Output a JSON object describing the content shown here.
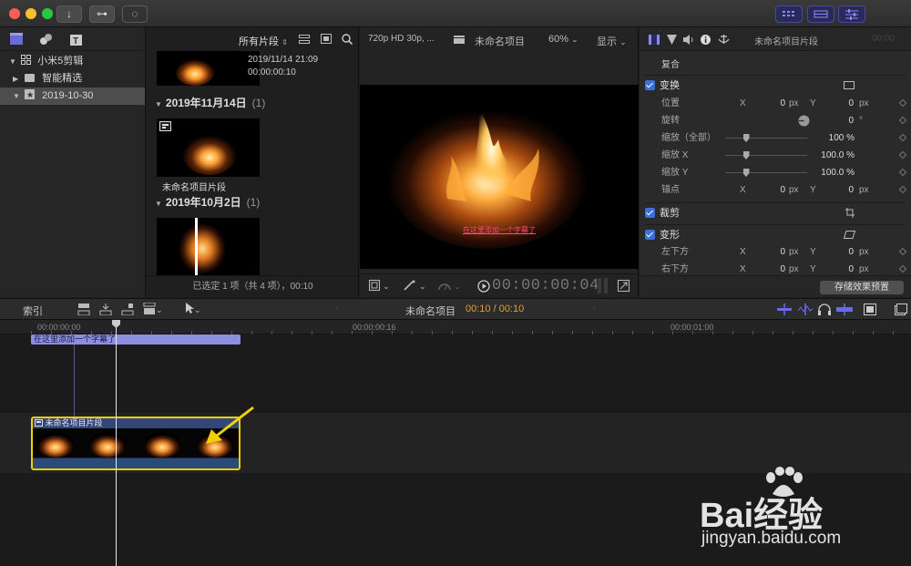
{
  "toolbar": {
    "import_icon": "↓",
    "keywords_icon": "⊶",
    "progress_icon": "◌"
  },
  "libraries": {
    "items": [
      {
        "label": "小米5剪辑",
        "icon": "library-icon",
        "expanded": true
      },
      {
        "label": "智能精选",
        "icon": "folder-icon",
        "expanded": false
      },
      {
        "label": "2019-10-30",
        "icon": "event-icon",
        "expanded": true,
        "selected": true
      }
    ]
  },
  "browser": {
    "filter_label": "所有片段",
    "top_clip": {
      "date": "2019/11/14 21:09",
      "duration": "00:00:00:10"
    },
    "groups": [
      {
        "date": "2019年11月14日",
        "count": "(1)",
        "clip_name": "未命名项目片段"
      },
      {
        "date": "2019年10月2日",
        "count": "(1)"
      }
    ],
    "status": "已选定 1 项（共 4 项），00:10"
  },
  "viewer": {
    "format": "720p HD 30p, ...",
    "project_name": "未命名项目",
    "zoom": "60%",
    "display": "显示",
    "subtitle": "在这里添加一个字幕了",
    "timecode": "00:00:00:04"
  },
  "inspector": {
    "clip_title": "未命名项目片段",
    "timecode_ghost": "00:00",
    "composite": "复合",
    "transform": "变换",
    "rows": [
      {
        "label": "位置",
        "x_label": "X",
        "x_val": "0",
        "x_unit": "px",
        "y_label": "Y",
        "y_val": "0",
        "y_unit": "px"
      },
      {
        "label": "旋转",
        "val": "0",
        "unit": "°"
      },
      {
        "label": "缩放（全部）",
        "val": "100 %",
        "slider": 0.25
      },
      {
        "label": "缩放 X",
        "val": "100.0 %",
        "slider": 0.25
      },
      {
        "label": "缩放 Y",
        "val": "100.0 %",
        "slider": 0.25
      },
      {
        "label": "锚点",
        "x_label": "X",
        "x_val": "0",
        "x_unit": "px",
        "y_label": "Y",
        "y_val": "0",
        "y_unit": "px"
      }
    ],
    "crop": "裁剪",
    "distort": "变形",
    "distort_rows": [
      {
        "label": "左下方",
        "x_label": "X",
        "x_val": "0",
        "x_unit": "px",
        "y_label": "Y",
        "y_val": "0",
        "y_unit": "px"
      },
      {
        "label": "右下方",
        "x_label": "X",
        "x_val": "0",
        "x_unit": "px",
        "y_label": "Y",
        "y_val": "0",
        "y_unit": "px"
      }
    ],
    "save_preset": "存储效果预置"
  },
  "timeline": {
    "index": "索引",
    "project": "未命名项目",
    "time": "00:10 / 00:10",
    "ruler": [
      "00:00:00:00",
      "00:00:00:16",
      "00:00:01:00"
    ],
    "title_clip": "在这里添加一个字幕了",
    "video_clip": "未命名项目片段"
  },
  "watermark": {
    "brand": "Bai经验",
    "url": "jingyan.baidu.com"
  },
  "colors": {
    "accent": "#3b6fd9",
    "title_clip": "#8c8fe0",
    "selection": "#f0d000",
    "time_orange": "#e0a030",
    "subtitle": "#ff4a7a"
  }
}
